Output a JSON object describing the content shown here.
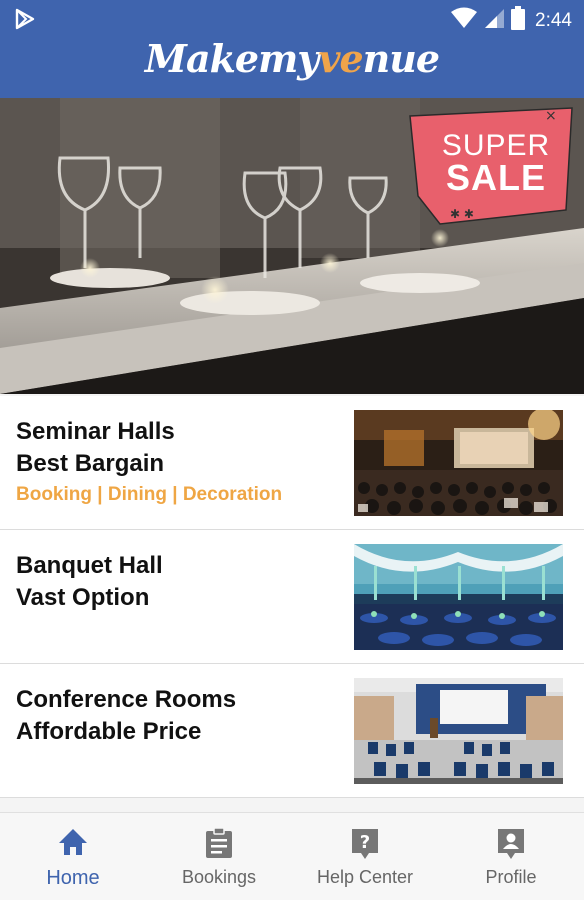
{
  "status_bar": {
    "time": "2:44"
  },
  "header": {
    "logo_part1": "Makemy",
    "logo_accent": "ve",
    "logo_part2": "nue"
  },
  "hero": {
    "badge_line1": "SUPER",
    "badge_line2": "SALE"
  },
  "cards": [
    {
      "title_line1": "Seminar Halls",
      "title_line2": "Best Bargain",
      "subtitle": "Booking | Dining | Decoration"
    },
    {
      "title_line1": "Banquet Hall",
      "title_line2": "Vast Option"
    },
    {
      "title_line1": "Conference Rooms",
      "title_line2": "Affordable Price"
    }
  ],
  "bottom_nav": [
    {
      "label": "Home",
      "icon": "home-icon",
      "active": true
    },
    {
      "label": "Bookings",
      "icon": "clipboard-icon",
      "active": false
    },
    {
      "label": "Help Center",
      "icon": "help-icon",
      "active": false
    },
    {
      "label": "Profile",
      "icon": "profile-icon",
      "active": false
    }
  ],
  "colors": {
    "header": "#3f64ae",
    "accent": "#efa644",
    "badge": "#e8606c"
  }
}
